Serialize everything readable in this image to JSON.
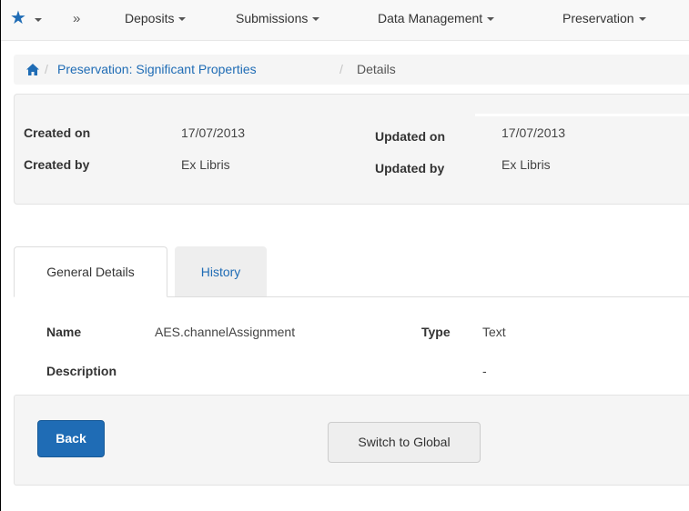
{
  "nav": {
    "items": [
      {
        "label": "Deposits"
      },
      {
        "label": "Submissions"
      },
      {
        "label": "Data Management"
      },
      {
        "label": "Preservation"
      }
    ]
  },
  "breadcrumb": {
    "link": "Preservation: Significant Properties",
    "current": "Details",
    "separator": "/"
  },
  "info": {
    "created_on_label": "Created on",
    "created_on_value": "17/07/2013",
    "created_by_label": "Created by",
    "created_by_value": "Ex Libris",
    "updated_on_label": "Updated on",
    "updated_on_value": "17/07/2013",
    "updated_by_label": "Updated by",
    "updated_by_value": "Ex Libris"
  },
  "tabs": [
    {
      "label": "General Details",
      "active": true
    },
    {
      "label": "History",
      "active": false
    }
  ],
  "details": {
    "name_label": "Name",
    "name_value": "AES.channelAssignment",
    "type_label": "Type",
    "type_value": "Text",
    "description_label": "Description",
    "description_value": "-"
  },
  "actions": {
    "back_label": "Back",
    "switch_label": "Switch to Global"
  },
  "colors": {
    "accent": "#1f6cb5",
    "panel": "#f5f5f5"
  },
  "icons": [
    "star-icon",
    "caret-down-icon",
    "double-chevron-icon",
    "home-icon"
  ]
}
